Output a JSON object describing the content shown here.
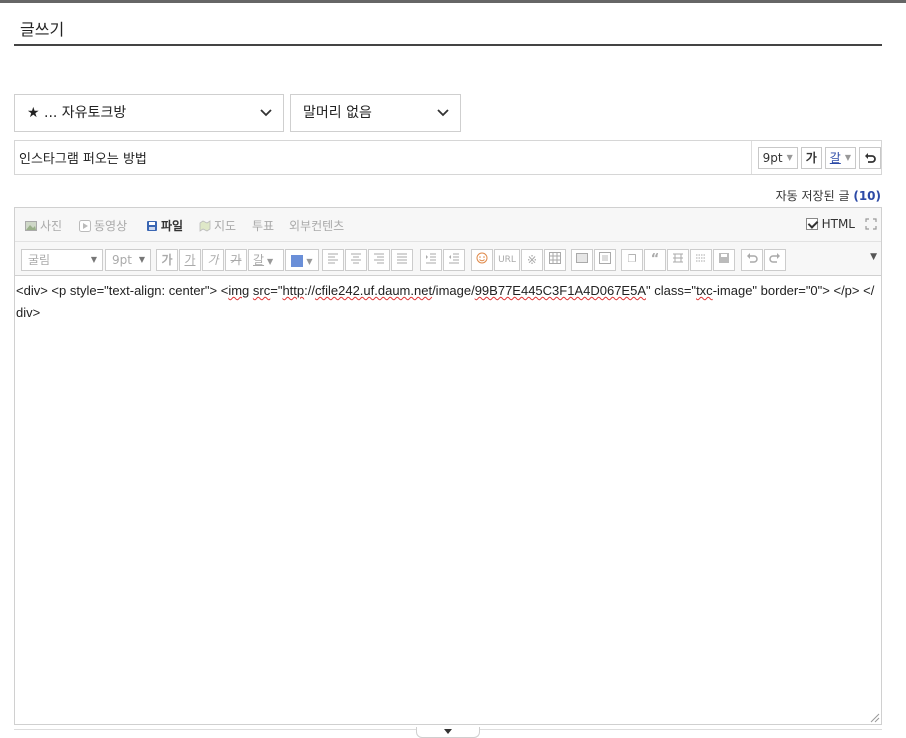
{
  "page": {
    "title": "글쓰기"
  },
  "selects": {
    "board": "★ ... 자유토크방",
    "header": "말머리 없음"
  },
  "subject": {
    "value": "인스타그램 퍼오는 방법",
    "font_size": "9pt",
    "bold_label": "가",
    "color_label": "갈"
  },
  "autosave": {
    "label": "자동 저장된 글",
    "count": "(10)"
  },
  "toolbar_attach": {
    "photo": "사진",
    "video": "동영상",
    "file": "파일",
    "map": "지도",
    "vote": "투표",
    "external": "외부컨텐츠",
    "html": "HTML"
  },
  "toolbar_format": {
    "font_family": "굴림",
    "font_size": "9pt",
    "bold": "가",
    "underline": "가",
    "italic": "가",
    "strike": "가",
    "color": "갈",
    "url": "URL"
  },
  "editor": {
    "seg1": "<div> <p style=\"text-align: center\"> <",
    "seg2": "img",
    "seg3": " ",
    "seg4": "src",
    "seg5": "=\"",
    "seg6": "http",
    "seg7": "://",
    "seg8": "cfile242.uf.daum.net",
    "seg9": "/image/",
    "seg10": "99B77E445C3F1A4D067E5A",
    "seg11": "\" class=\"",
    "seg12": "txc",
    "seg13": "-image\" border=\"0\"> </p> </div>"
  }
}
